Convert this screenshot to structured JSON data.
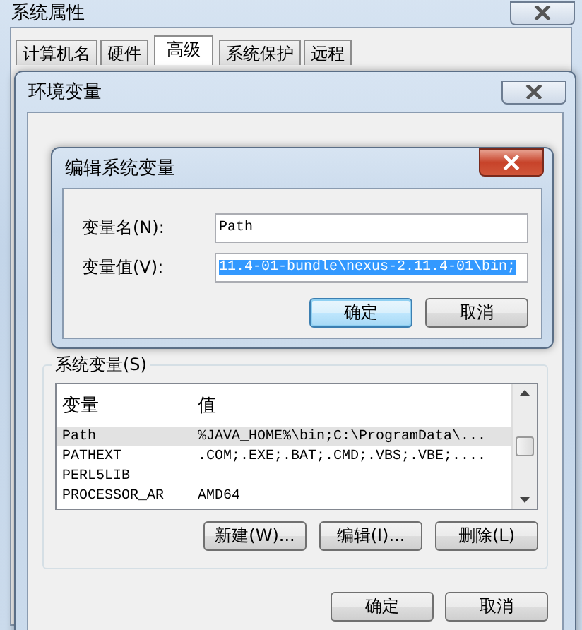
{
  "outer_window": {
    "title": "系统属性",
    "tabs": [
      {
        "label": "计算机名",
        "selected": false
      },
      {
        "label": "硬件",
        "selected": false
      },
      {
        "label": "高级",
        "selected": true
      },
      {
        "label": "系统保护",
        "selected": false
      },
      {
        "label": "远程",
        "selected": false
      }
    ]
  },
  "env_window": {
    "title": "环境变量",
    "system_vars": {
      "label": "系统变量(S)",
      "columns": [
        "变量",
        "值"
      ],
      "rows": [
        {
          "name": "Path",
          "value": "%JAVA_HOME%\\bin;C:\\ProgramData\\...",
          "selected": true
        },
        {
          "name": "PATHEXT",
          "value": ".COM;.EXE;.BAT;.CMD;.VBS;.VBE;....",
          "selected": false
        },
        {
          "name": "PERL5LIB",
          "value": "",
          "selected": false
        },
        {
          "name": "PROCESSOR_AR",
          "value": "AMD64",
          "selected": false
        }
      ],
      "buttons": [
        "新建(W)...",
        "编辑(I)...",
        "删除(L)"
      ]
    },
    "buttons": [
      "确定",
      "取消"
    ]
  },
  "edit_dialog": {
    "title": "编辑系统变量",
    "fields": [
      {
        "label": "变量名(N):",
        "value": "Path",
        "highlighted": false
      },
      {
        "label": "变量值(V):",
        "value": "11.4-01-bundle\\nexus-2.11.4-01\\bin;",
        "highlighted": true
      }
    ],
    "buttons": [
      {
        "label": "确定",
        "default": true
      },
      {
        "label": "取消",
        "default": false
      }
    ]
  }
}
